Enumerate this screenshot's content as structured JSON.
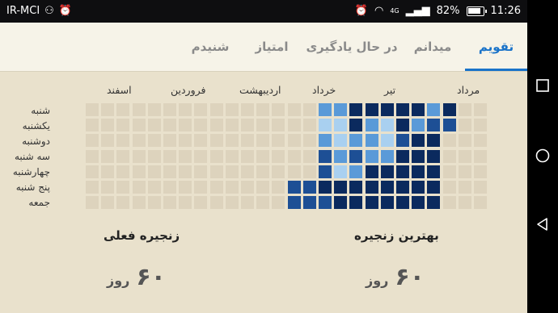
{
  "status": {
    "carrier": "IR-MCI",
    "battery_percent": "82%",
    "time": "11:26",
    "network": "4G"
  },
  "tabs": [
    {
      "label": "تقویم",
      "active": true
    },
    {
      "label": "میدانم",
      "active": false
    },
    {
      "label": "در حال یادگیری",
      "active": false
    },
    {
      "label": "امتیاز",
      "active": false
    },
    {
      "label": "شنیدم",
      "active": false
    }
  ],
  "calendar": {
    "months": [
      "مرداد",
      "تیر",
      "خرداد",
      "اردیبهشت",
      "فروردین",
      "اسفند"
    ],
    "days": [
      "شنبه",
      "یکشنبه",
      "دوشنبه",
      "سه شنبه",
      "چهارشنبه",
      "پنج شنبه",
      "جمعه"
    ],
    "colors": {
      "empty": "#ddd3bd",
      "level1": "#a9d0f0",
      "level2": "#5a9ad8",
      "level3": "#1d4f95",
      "level4": "#0b2a5e"
    },
    "weeks": [
      [
        0,
        0,
        0,
        0,
        0,
        0,
        0
      ],
      [
        0,
        0,
        0,
        0,
        0,
        0,
        0
      ],
      [
        0,
        0,
        0,
        0,
        0,
        0,
        0
      ],
      [
        0,
        0,
        0,
        0,
        0,
        0,
        0
      ],
      [
        0,
        0,
        0,
        0,
        0,
        0,
        0
      ],
      [
        0,
        0,
        0,
        0,
        0,
        0,
        0
      ],
      [
        0,
        0,
        0,
        0,
        0,
        0,
        0
      ],
      [
        0,
        0,
        0,
        0,
        0,
        0,
        0
      ],
      [
        0,
        0,
        0,
        0,
        0,
        0,
        0
      ],
      [
        0,
        0,
        0,
        0,
        0,
        0,
        0
      ],
      [
        0,
        0,
        0,
        0,
        0,
        0,
        0
      ],
      [
        0,
        0,
        0,
        0,
        0,
        0,
        0
      ],
      [
        0,
        0,
        0,
        0,
        0,
        0,
        0
      ],
      [
        0,
        0,
        0,
        0,
        0,
        3,
        3
      ],
      [
        0,
        0,
        0,
        0,
        0,
        3,
        3
      ],
      [
        2,
        1,
        2,
        3,
        3,
        4,
        3
      ],
      [
        2,
        1,
        1,
        2,
        1,
        4,
        4
      ],
      [
        4,
        4,
        2,
        3,
        2,
        4,
        4
      ],
      [
        4,
        2,
        2,
        2,
        4,
        4,
        4
      ],
      [
        4,
        1,
        1,
        2,
        4,
        4,
        4
      ],
      [
        4,
        4,
        3,
        4,
        4,
        4,
        4
      ],
      [
        4,
        2,
        4,
        4,
        4,
        4,
        4
      ],
      [
        2,
        3,
        4,
        4,
        4,
        4,
        4
      ],
      [
        4,
        3,
        0,
        0,
        0,
        0,
        0
      ],
      [
        0,
        0,
        0,
        0,
        0,
        0,
        0
      ],
      [
        0,
        0,
        0,
        0,
        0,
        0,
        0
      ]
    ]
  },
  "streaks": {
    "best_title": "بهترین زنجیره",
    "best_value": "۶۰",
    "best_unit": "روز",
    "current_title": "زنجیره فعلی",
    "current_value": "۶۰",
    "current_unit": "روز"
  }
}
